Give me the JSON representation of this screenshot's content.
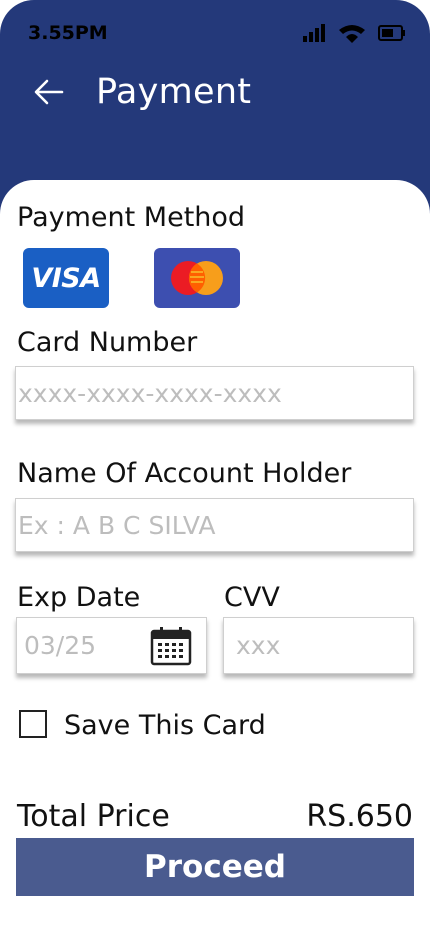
{
  "status_bar": {
    "time": "3.55PM"
  },
  "header": {
    "title": "Payment"
  },
  "payment_method": {
    "label": "Payment Method",
    "options": [
      {
        "name": "VISA",
        "color": "#1a5fc4"
      },
      {
        "name": "Mastercard",
        "color": "#3d4fb0"
      }
    ]
  },
  "card_number": {
    "label": "Card Number",
    "placeholder": "xxxx-xxxx-xxxx-xxxx"
  },
  "account_holder": {
    "label": "Name Of Account Holder",
    "placeholder": "Ex : A B C SILVA"
  },
  "exp_date": {
    "label": "Exp Date",
    "placeholder": "03/25"
  },
  "cvv": {
    "label": "CVV",
    "placeholder": "xxx"
  },
  "save_card": {
    "label": "Save This Card",
    "checked": false
  },
  "total": {
    "label": "Total Price",
    "value": "RS.650"
  },
  "proceed": {
    "label": "Proceed"
  },
  "colors": {
    "header_bg": "#24397a",
    "button_bg": "#4a5b8f"
  }
}
